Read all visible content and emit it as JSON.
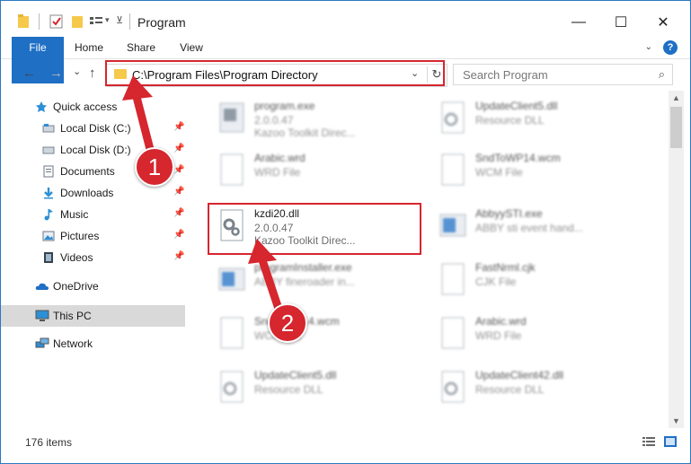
{
  "window": {
    "title": "Program",
    "controls": {
      "minimize": "—",
      "maximize": "☐",
      "close": "✕"
    }
  },
  "ribbon": {
    "tabs": [
      "File",
      "Home",
      "Share",
      "View"
    ],
    "help": "?"
  },
  "navigation": {
    "back": "←",
    "forward": "→",
    "recent": "⌄",
    "up": "↑",
    "address": "C:\\Program Files\\Program Directory",
    "search_placeholder": "Search Program"
  },
  "sidebar": {
    "items": [
      {
        "label": "Quick access",
        "icon": "star-icon",
        "pinned": false
      },
      {
        "label": "Local Disk (C:)",
        "icon": "drive-icon",
        "pinned": true
      },
      {
        "label": "Local Disk (D:)",
        "icon": "drive-icon",
        "pinned": true
      },
      {
        "label": "Documents",
        "icon": "documents-icon",
        "pinned": true
      },
      {
        "label": "Downloads",
        "icon": "download-icon",
        "pinned": true
      },
      {
        "label": "Music",
        "icon": "music-icon",
        "pinned": true
      },
      {
        "label": "Pictures",
        "icon": "pictures-icon",
        "pinned": true
      },
      {
        "label": "Videos",
        "icon": "videos-icon",
        "pinned": true
      },
      {
        "label": "OneDrive",
        "icon": "cloud-icon",
        "pinned": false
      },
      {
        "label": "This PC",
        "icon": "computer-icon",
        "pinned": false,
        "selected": true
      },
      {
        "label": "Network",
        "icon": "network-icon",
        "pinned": false
      }
    ]
  },
  "files": [
    {
      "name": "program.exe",
      "line2": "2.0.0.47",
      "line3": "Kazoo Toolkit Direc...",
      "icon": "exe-icon",
      "blurred": true
    },
    {
      "name": "UpdateClient5.dll",
      "line2": "Resource DLL",
      "line3": "",
      "icon": "dll-icon",
      "blurred": true
    },
    {
      "name": "Arabic.wrd",
      "line2": "WRD File",
      "line3": "",
      "icon": "blank-file-icon",
      "blurred": true
    },
    {
      "name": "SndToWP14.wcm",
      "line2": "WCM File",
      "line3": "",
      "icon": "blank-file-icon",
      "blurred": true
    },
    {
      "name": "kzdi20.dll",
      "line2": "2.0.0.47",
      "line3": "Kazoo Toolkit Direc...",
      "icon": "dll-gear-icon",
      "blurred": false
    },
    {
      "name": "AbbyySTI.exe",
      "line2": "ABBY sti event hand...",
      "line3": "",
      "icon": "installer-icon",
      "blurred": true
    },
    {
      "name": "programInstaller.exe",
      "line2": "ABBY fineroader in...",
      "line3": "",
      "icon": "installer-icon",
      "blurred": true
    },
    {
      "name": "FastNrml.cjk",
      "line2": "CJK File",
      "line3": "",
      "icon": "blank-file-icon",
      "blurred": true
    },
    {
      "name": "SndToWP14.wcm",
      "line2": "WCM File",
      "line3": "",
      "icon": "blank-file-icon",
      "blurred": true
    },
    {
      "name": "Arabic.wrd",
      "line2": "WRD File",
      "line3": "",
      "icon": "blank-file-icon",
      "blurred": true
    },
    {
      "name": "UpdateClient5.dll",
      "line2": "Resource DLL",
      "line3": "",
      "icon": "dll-icon",
      "blurred": true
    },
    {
      "name": "UpdateClient42.dll",
      "line2": "Resource DLL",
      "line3": "",
      "icon": "dll-icon",
      "blurred": true
    }
  ],
  "status": {
    "item_count": "176 items"
  },
  "annotations": {
    "step1": "1",
    "step2": "2"
  },
  "colors": {
    "accent": "#1f6fc5",
    "highlight": "#d6262e",
    "folder": "#f6c94b"
  }
}
